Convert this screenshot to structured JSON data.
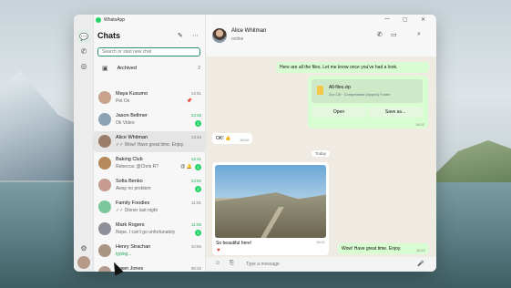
{
  "app": {
    "title": "WhatsApp"
  },
  "window_controls": [
    "—",
    "▢",
    "✕"
  ],
  "rail": {
    "icons": [
      "chats-icon",
      "calls-icon",
      "status-icon",
      "settings-icon",
      "profile-icon"
    ]
  },
  "sidebar": {
    "title": "Chats",
    "new_chat_icon": "✎",
    "menu_icon": "⋯",
    "search_placeholder": "Search or start new chat",
    "archived": {
      "label": "Archived",
      "count": "2"
    },
    "chats": [
      {
        "name": "Maya Kusumo",
        "preview": "Pet Ox",
        "time": "14:51",
        "badge": "",
        "extra": "📌",
        "color": "#c7a48b"
      },
      {
        "name": "Jason Bellmer",
        "preview": "Ok Video",
        "time": "13:26",
        "badge": "1",
        "extra": "",
        "color": "#8aa1b6",
        "green_time": true
      },
      {
        "name": "Alice Whitman",
        "preview": "✓✓ Wow! Have great time. Enjoy.",
        "time": "13:34",
        "badge": "",
        "extra": "",
        "color": "#9c7d6a",
        "selected": true
      },
      {
        "name": "Baking Club",
        "preview": "Rebecca: @Chris R?",
        "time": "14:41",
        "badge": "1",
        "extra": "@ 🔔",
        "color": "#b5895b",
        "green_time": true
      },
      {
        "name": "Sofia Benko",
        "preview": "Away no problem",
        "time": "13:50",
        "badge": "2",
        "extra": "",
        "color": "#c59b8f",
        "green_time": true
      },
      {
        "name": "Family Foodies",
        "preview": "✓✓ Dinner last night",
        "time": "11:01",
        "badge": "",
        "extra": "",
        "color": "#7ec69b"
      },
      {
        "name": "Mark Rogers",
        "preview": "Nope. I can't go unfortunately",
        "time": "11:05",
        "badge": "1",
        "extra": "",
        "color": "#8c8f98",
        "green_time": true
      },
      {
        "name": "Henry Strachan",
        "preview": "typing...",
        "time": "10:56",
        "badge": "",
        "extra": "",
        "color": "#a99581",
        "green_preview": true
      },
      {
        "name": "Dawn Jones",
        "preview": "",
        "time": "08:32",
        "badge": "",
        "extra": "",
        "color": "#b49a8e"
      }
    ]
  },
  "conversation": {
    "contact_name": "Alice Whitman",
    "status": "online",
    "messages": {
      "m1": {
        "text": "Here are all the files. Let me know once you've had a look.",
        "time": "16:02"
      },
      "file": {
        "name": "All-files.zip",
        "meta": "Zcx 1/8 · Compressed (zipped) Folder",
        "open": "Open",
        "save": "Save as...",
        "time": "16:02"
      },
      "m2": {
        "text": "OK! 👍",
        "time": "16:04"
      },
      "day": "Today",
      "photo": {
        "caption": "So beautiful here!",
        "reaction": "♥",
        "time": "16:21"
      },
      "m3": {
        "text": "Wow! Have great time. Enjoy.",
        "time": "16:22"
      }
    },
    "composer": {
      "placeholder": "Type a message"
    }
  }
}
